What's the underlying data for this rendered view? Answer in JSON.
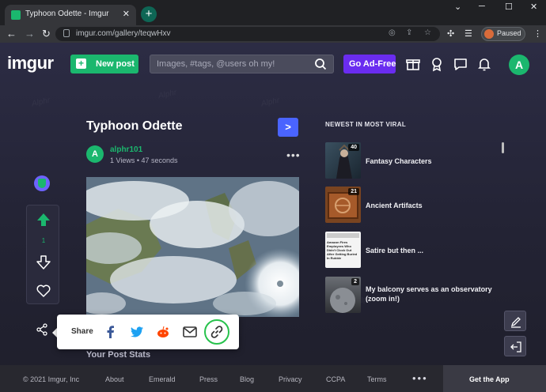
{
  "browser": {
    "tab_title": "Typhoon Odette - Imgur",
    "tab_close": "✕",
    "new_tab": "+",
    "url": "imgur.com/gallery/teqwHxv",
    "profile_status": "Paused",
    "win_min": "─",
    "win_max": "☐",
    "win_close": "✕",
    "back": "←",
    "forward": "→",
    "reload": "↻"
  },
  "header": {
    "logo": "imgur",
    "new_post_label": "New post",
    "search_placeholder": "Images, #tags, @users oh my!",
    "ad_free_label": "Go Ad-Free",
    "avatar_letter": "A"
  },
  "post": {
    "title": "Typhoon Odette",
    "next_label": ">",
    "user_initial": "A",
    "username": "alphr101",
    "meta": "1 Views • 47 seconds",
    "more": "•••",
    "vote_count": "1",
    "stats_label": "Your Post Stats"
  },
  "share": {
    "label": "Share"
  },
  "sidebar": {
    "heading": "NEWEST IN MOST VIRAL",
    "items": [
      {
        "title": "Fantasy Characters",
        "badge": "40"
      },
      {
        "title": "Ancient Artifacts",
        "badge": "21"
      },
      {
        "title": "Satire but then ...",
        "badge": "",
        "thumb_text": "Amazon Fires Employees Who Didn't Clock Out After Getting Buried In Rubble"
      },
      {
        "title": "My balcony serves as an observatory (zoom in!)",
        "badge": "2"
      }
    ]
  },
  "footer": {
    "copyright": "© 2021 Imgur, Inc",
    "links": [
      "About",
      "Emerald",
      "Press",
      "Blog",
      "Privacy",
      "CCPA",
      "Terms"
    ],
    "more": "•••",
    "get_app": "Get the App"
  },
  "colors": {
    "imgur_green": "#1bb76e",
    "ad_free_purple": "#6a2cf0",
    "next_blue": "#4a64ff"
  }
}
